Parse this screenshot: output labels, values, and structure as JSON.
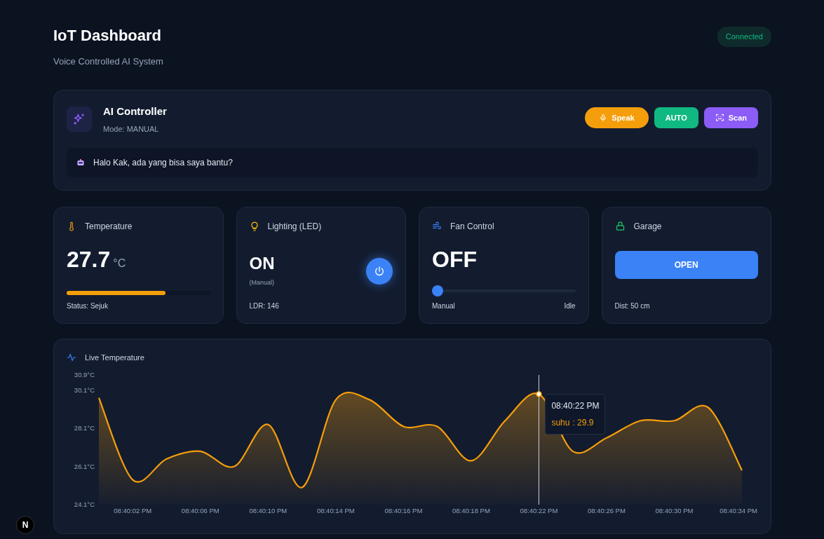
{
  "header": {
    "title": "IoT Dashboard",
    "subtitle": "Voice Controlled AI System",
    "status": {
      "label": "Connected",
      "connected": true
    }
  },
  "ai_controller": {
    "title": "AI Controller",
    "mode": "Mode: MANUAL",
    "buttons": [
      {
        "label": "Speak",
        "kind": "speak"
      },
      {
        "label": "AUTO",
        "kind": "auto"
      },
      {
        "label": "Scan",
        "kind": "scan"
      }
    ],
    "message": "Halo Kak, ada yang bisa saya bantu?"
  },
  "cards": [
    {
      "kind": "temperature",
      "title": "Temperature",
      "value": "27.7",
      "unit": "°C",
      "level": 0.69,
      "footer": "Status: Sejuk"
    },
    {
      "kind": "lighting",
      "title": "Lighting (LED)",
      "value": "ON",
      "note": "(Manual)",
      "on": true,
      "footer": "LDR: 146"
    },
    {
      "kind": "fan",
      "title": "Fan Control",
      "value": "OFF",
      "level": 0,
      "footer": "Manual",
      "footer_right": "Idle"
    },
    {
      "kind": "garage",
      "title": "Garage",
      "button": "OPEN",
      "footer": "Dist: 50 cm"
    }
  ],
  "live_chart": {
    "title": "Live Temperature",
    "chart_data": {
      "type": "area",
      "categories": [
        null,
        "08:40:02 PM",
        null,
        "08:40:06 PM",
        null,
        "08:40:10 PM",
        null,
        "08:40:14 PM",
        null,
        "08:40:16 PM",
        null,
        "08:40:18 PM",
        null,
        "08:40:22 PM",
        null,
        "08:40:26 PM",
        null,
        "08:40:30 PM",
        null,
        "08:40:34 PM"
      ],
      "series": [
        {
          "name": "suhu",
          "color": "#f59e0b",
          "values": [
            29.7,
            25.4,
            26.5,
            26.9,
            26.1,
            28.3,
            25.0,
            29.6,
            29.6,
            28.2,
            28.2,
            26.4,
            28.5,
            29.9,
            26.9,
            27.6,
            28.5,
            28.5,
            29.2,
            25.9
          ]
        }
      ],
      "ylim": [
        24.1,
        30.9
      ],
      "yticks": [
        {
          "value": 24.1,
          "label": "24.1°C"
        },
        {
          "value": 26.1,
          "label": "26.1°C"
        },
        {
          "value": 28.1,
          "label": "28.1°C"
        },
        {
          "value": 30.1,
          "label": "30.1°C"
        },
        {
          "value": 30.9,
          "label": "30.9°C"
        }
      ]
    },
    "tooltip": {
      "time": "08:40:22 PM",
      "value": ": 29.9"
    }
  },
  "dev_badge": {
    "label": "N"
  }
}
